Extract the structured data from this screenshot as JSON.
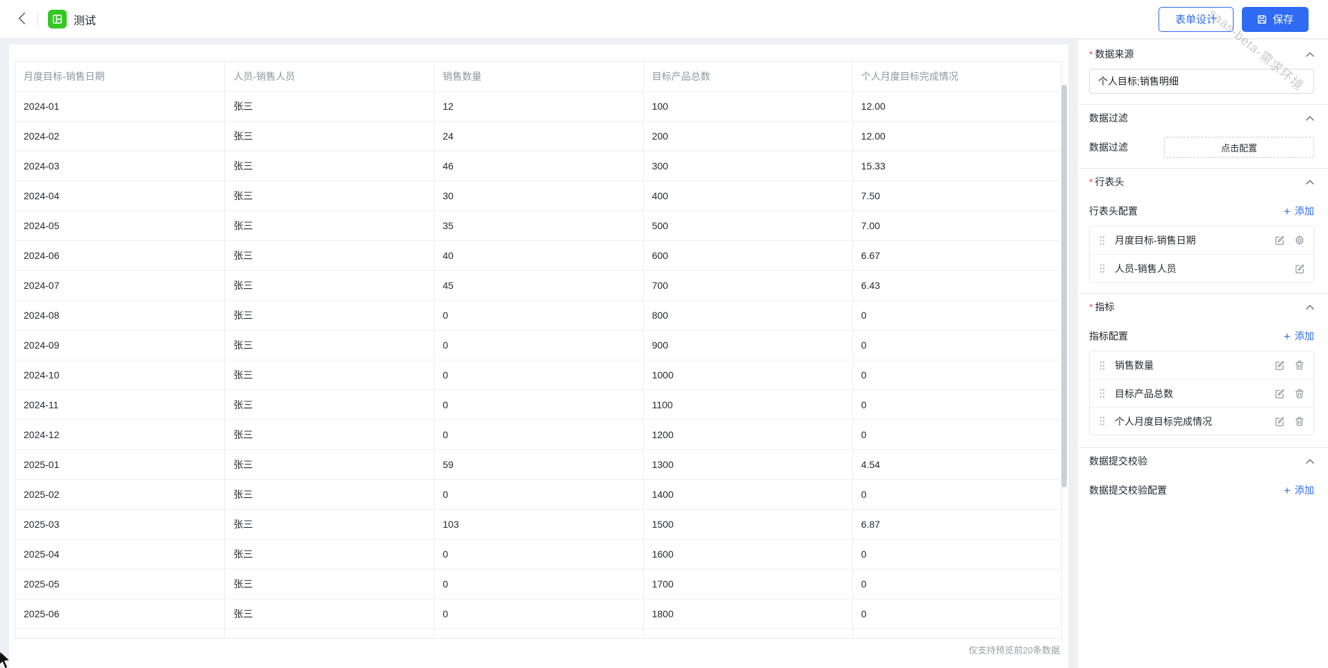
{
  "topbar": {
    "title": "测试",
    "form_design_label": "表单设计",
    "save_label": "保存"
  },
  "watermark": "saas-beta-需求环境",
  "colors": {
    "primary_blue": "#2e6bf2",
    "app_green": "#34c724",
    "required_red": "#f54a45",
    "text_dark": "#1f2329",
    "text_gray": "#8f959e"
  },
  "table": {
    "columns": [
      "月度目标-销售日期",
      "人员-销售人员",
      "销售数量",
      "目标产品总数",
      "个人月度目标完成情况"
    ],
    "rows": [
      [
        "2024-01",
        "张三",
        "12",
        "100",
        "12.00"
      ],
      [
        "2024-02",
        "张三",
        "24",
        "200",
        "12.00"
      ],
      [
        "2024-03",
        "张三",
        "46",
        "300",
        "15.33"
      ],
      [
        "2024-04",
        "张三",
        "30",
        "400",
        "7.50"
      ],
      [
        "2024-05",
        "张三",
        "35",
        "500",
        "7.00"
      ],
      [
        "2024-06",
        "张三",
        "40",
        "600",
        "6.67"
      ],
      [
        "2024-07",
        "张三",
        "45",
        "700",
        "6.43"
      ],
      [
        "2024-08",
        "张三",
        "0",
        "800",
        "0"
      ],
      [
        "2024-09",
        "张三",
        "0",
        "900",
        "0"
      ],
      [
        "2024-10",
        "张三",
        "0",
        "1000",
        "0"
      ],
      [
        "2024-11",
        "张三",
        "0",
        "1100",
        "0"
      ],
      [
        "2024-12",
        "张三",
        "0",
        "1200",
        "0"
      ],
      [
        "2025-01",
        "张三",
        "59",
        "1300",
        "4.54"
      ],
      [
        "2025-02",
        "张三",
        "0",
        "1400",
        "0"
      ],
      [
        "2025-03",
        "张三",
        "103",
        "1500",
        "6.87"
      ],
      [
        "2025-04",
        "张三",
        "0",
        "1600",
        "0"
      ],
      [
        "2025-05",
        "张三",
        "0",
        "1700",
        "0"
      ],
      [
        "2025-06",
        "张三",
        "0",
        "1800",
        "0"
      ]
    ],
    "footer_note": "仅支持预览前20条数据"
  },
  "panel": {
    "data_source": {
      "label": "数据来源",
      "required": true,
      "value": "个人目标;销售明细"
    },
    "data_filter": {
      "title": "数据过滤",
      "label": "数据过滤",
      "button_label": "点击配置"
    },
    "row_header": {
      "title": "行表头",
      "required": true,
      "config_label": "行表头配置",
      "add_label": "添加",
      "items": [
        {
          "label": "月度目标-销售日期",
          "icons": [
            "edit",
            "gear"
          ]
        },
        {
          "label": "人员-销售人员",
          "icons": [
            "edit"
          ]
        }
      ]
    },
    "metrics": {
      "title": "指标",
      "required": true,
      "config_label": "指标配置",
      "add_label": "添加",
      "items": [
        {
          "label": "销售数量",
          "icons": [
            "edit",
            "trash"
          ]
        },
        {
          "label": "目标产品总数",
          "icons": [
            "edit",
            "trash"
          ]
        },
        {
          "label": "个人月度目标完成情况",
          "icons": [
            "edit",
            "trash"
          ]
        }
      ]
    },
    "validation": {
      "title": "数据提交校验",
      "config_label": "数据提交校验配置",
      "add_label": "添加"
    }
  }
}
